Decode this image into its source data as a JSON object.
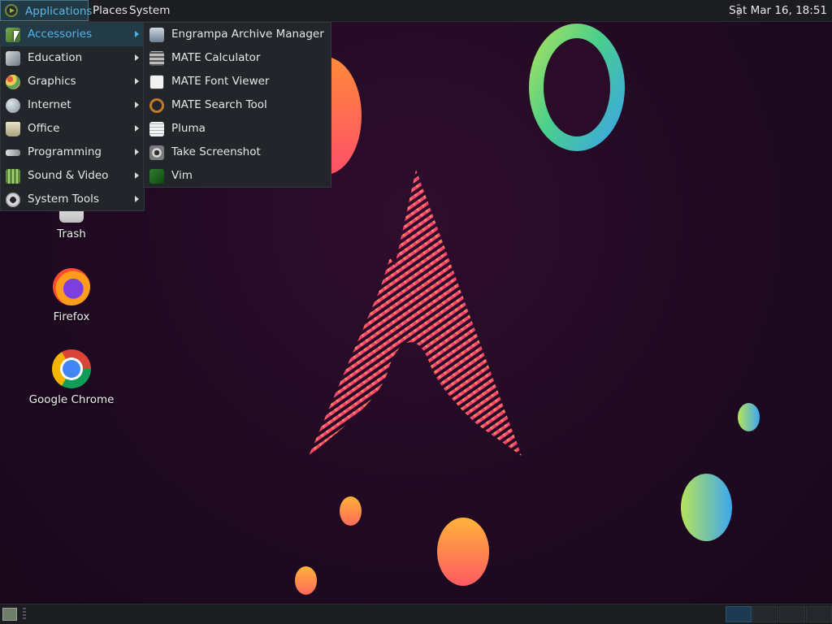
{
  "top_panel": {
    "applications_label": "Applications",
    "places_label": "Places",
    "system_label": "System",
    "clock": "Sat Mar 16, 18:51"
  },
  "menu": {
    "categories": [
      {
        "label": "Accessories",
        "icon": "accessories-icon",
        "active": true
      },
      {
        "label": "Education",
        "icon": "education-icon"
      },
      {
        "label": "Graphics",
        "icon": "graphics-icon"
      },
      {
        "label": "Internet",
        "icon": "internet-icon"
      },
      {
        "label": "Office",
        "icon": "office-icon"
      },
      {
        "label": "Programming",
        "icon": "programming-icon"
      },
      {
        "label": "Sound & Video",
        "icon": "sound-video-icon"
      },
      {
        "label": "System Tools",
        "icon": "system-tools-icon"
      }
    ],
    "accessories": [
      {
        "label": "Engrampa Archive Manager",
        "icon": "archive-manager-icon"
      },
      {
        "label": "MATE Calculator",
        "icon": "calculator-icon"
      },
      {
        "label": "MATE Font Viewer",
        "icon": "font-viewer-icon"
      },
      {
        "label": "MATE Search Tool",
        "icon": "search-tool-icon"
      },
      {
        "label": "Pluma",
        "icon": "text-editor-icon"
      },
      {
        "label": "Take Screenshot",
        "icon": "screenshot-icon"
      },
      {
        "label": "Vim",
        "icon": "vim-icon"
      }
    ]
  },
  "desktop": {
    "icons": [
      {
        "label": "Trash",
        "icon": "trash-icon"
      },
      {
        "label": "Firefox",
        "icon": "firefox-icon"
      },
      {
        "label": "Google Chrome",
        "icon": "chrome-icon"
      }
    ]
  },
  "colors": {
    "accent": "#4fb3ec",
    "panel": "#1b1d20",
    "menu_bg": "#22262a",
    "desktop_bg": "#200a22"
  }
}
